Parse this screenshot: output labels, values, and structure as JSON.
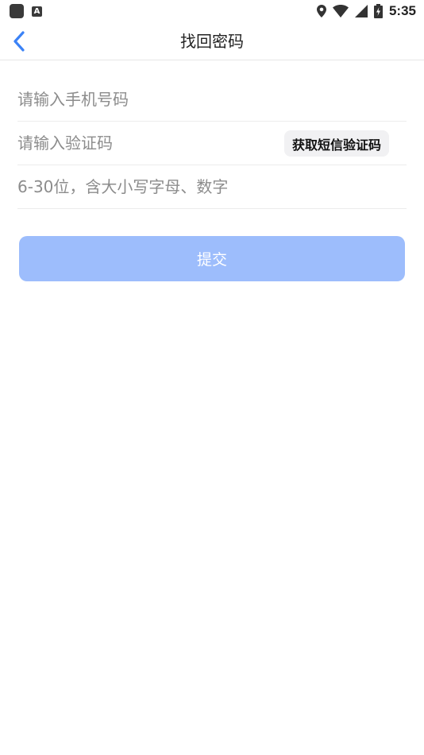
{
  "status_bar": {
    "time": "5:35",
    "notification_badge": "A",
    "icons": [
      "app-icon",
      "a-badge-icon",
      "location-icon",
      "wifi-icon",
      "signal-icon",
      "battery-icon"
    ]
  },
  "header": {
    "title": "找回密码",
    "back_icon": "chevron-left-icon"
  },
  "form": {
    "phone_placeholder": "请输入手机号码",
    "phone_value": "",
    "code_placeholder": "请输入验证码",
    "code_value": "",
    "sms_button_label": "获取短信验证码",
    "password_placeholder": "6-30位，含大小写字母、数字",
    "password_value": "",
    "submit_label": "提交"
  },
  "colors": {
    "accent": "#3b82f6",
    "submit_disabled": "#9dbdfc",
    "divider": "#ececec",
    "placeholder": "#8c8c8c"
  }
}
